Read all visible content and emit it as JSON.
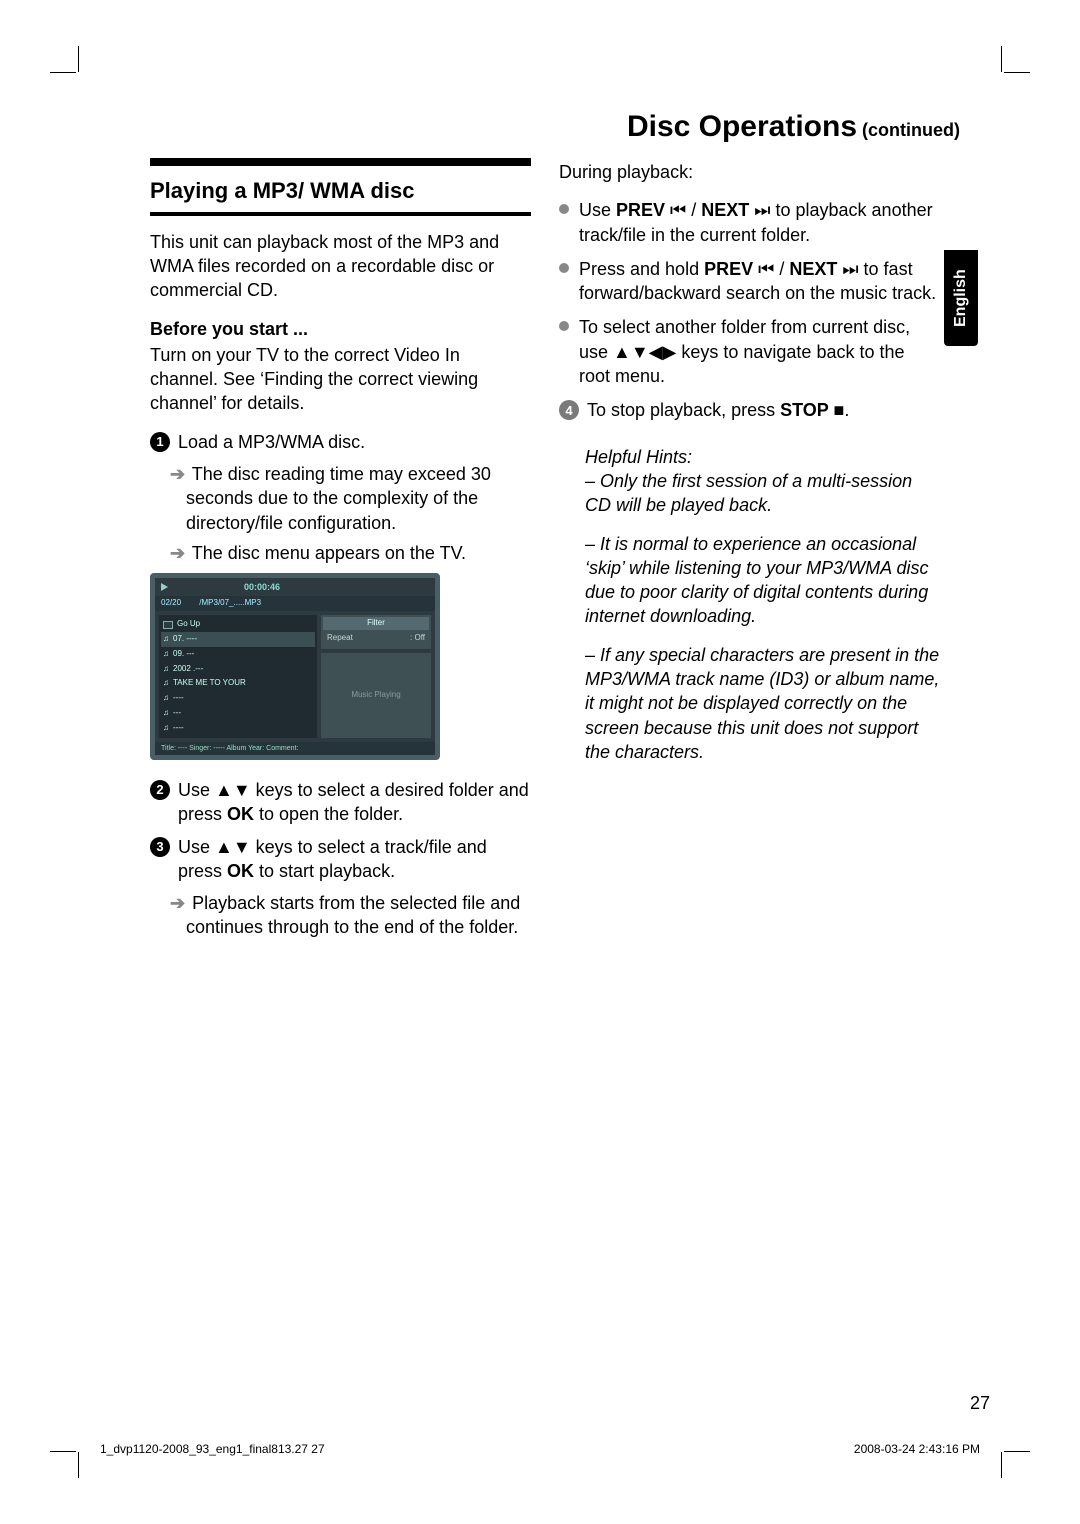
{
  "page": {
    "language_tab": "English",
    "title": "Disc Operations",
    "title_cont": " (continued)",
    "page_number": "27",
    "footer_left": "1_dvp1120-2008_93_eng1_final813.27   27",
    "footer_right": "2008-03-24   2:43:16 PM"
  },
  "left": {
    "section_title": "Playing a MP3/ WMA disc",
    "intro": "This unit can playback most of the MP3 and WMA files recorded on a recordable disc or commercial CD.",
    "before_head": "Before you start ...",
    "before_body": "Turn on your TV to the correct Video In channel. See ‘Finding the correct viewing channel’ for details.",
    "step1": "Load a MP3/WMA disc.",
    "step1_a": "The disc reading time may exceed 30 seconds due to the complexity of the directory/file configuration.",
    "step1_b": "The disc menu appears on the TV.",
    "step2_a": "Use ",
    "step2_keys": "▲▼",
    "step2_b": " keys to select a desired folder and press ",
    "step2_ok": "OK",
    "step2_c": " to open the folder.",
    "step3_a": "Use ",
    "step3_keys": "▲▼",
    "step3_b": " keys to select a track/file and press ",
    "step3_ok": "OK",
    "step3_c": " to start playback.",
    "step3_arrow": "Playback starts from the selected file and continues through to the end of the folder."
  },
  "right": {
    "during": "During playback:",
    "b1_a": "Use ",
    "b1_prev": "PREV ",
    "b1_prev_sym": "⏮",
    "b1_mid": " / ",
    "b1_next": "NEXT ",
    "b1_next_sym": "⏭",
    "b1_b": " to playback another track/file in the current folder.",
    "b2_a": "Press and hold ",
    "b2_prev": "PREV ",
    "b2_prev_sym": "⏮",
    "b2_mid": " / ",
    "b2_next": "NEXT ",
    "b2_next_sym": "⏭",
    "b2_b": " to fast forward/backward search on the music track.",
    "b3_a": "To select another folder from current disc, use ",
    "b3_keys": "▲▼◀▶",
    "b3_b": " keys to navigate back to the root menu.",
    "step4_a": "To stop playback, press ",
    "step4_stop": "STOP ",
    "step4_stop_sym": "■",
    "step4_b": ".",
    "hints_head": "Helpful Hints:",
    "hint1": "–  Only the first session of a multi-session CD will be played back.",
    "hint2": "–  It is normal to experience an occasional ‘skip’ while listening to your MP3/WMA disc due to poor clarity of digital contents during internet downloading.",
    "hint3": "–  If any special characters are present in the MP3/WMA track name (ID3) or album name, it might not be displayed correctly on the screen because this unit does not support the characters."
  },
  "tv": {
    "time": "00:00:46",
    "path_a": "02/20",
    "path_b": "/MP3/07_.....MP3",
    "rows": [
      {
        "icon": "up",
        "label": "Go Up"
      },
      {
        "icon": "note",
        "label": "07. ----",
        "sel": true
      },
      {
        "icon": "note",
        "label": "09. ---"
      },
      {
        "icon": "note",
        "label": "2002 .---"
      },
      {
        "icon": "note",
        "label": "TAKE ME TO YOUR"
      },
      {
        "icon": "note",
        "label": "----"
      },
      {
        "icon": "note",
        "label": "---"
      },
      {
        "icon": "note",
        "label": "----"
      }
    ],
    "filter_head": "Filter",
    "repeat_label": "Repeat",
    "repeat_value": ": Off",
    "music_playing": "Music Playing",
    "bottom": "Title: ----  Singer: -----    Album Year:     Comment:"
  }
}
